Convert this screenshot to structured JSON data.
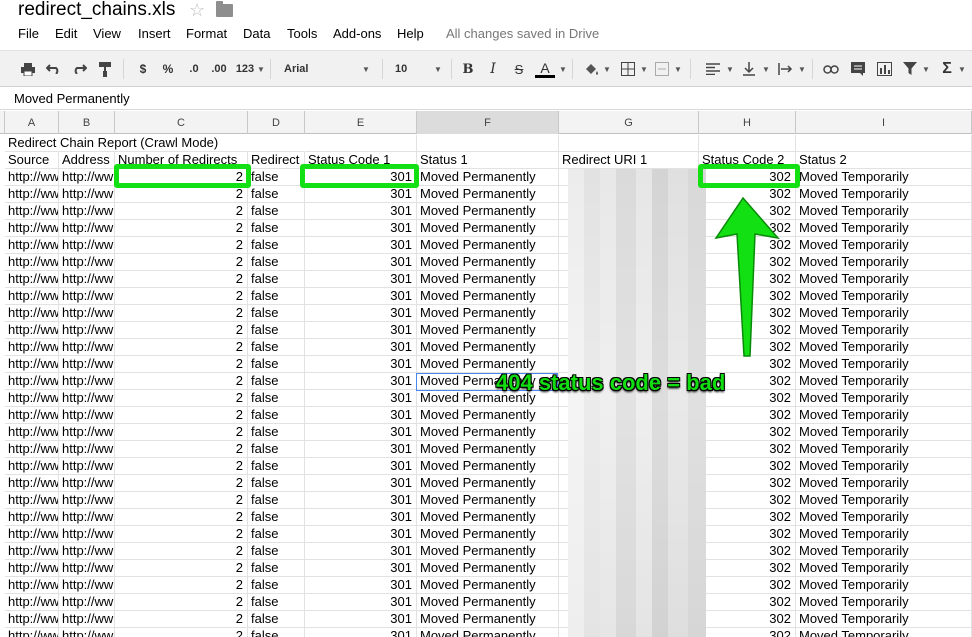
{
  "title_bar": {
    "doc_title": "redirect_chains.xls",
    "star_icon": "star-icon",
    "folder_icon": "folder-icon"
  },
  "menu": {
    "items": [
      "File",
      "Edit",
      "View",
      "Insert",
      "Format",
      "Data",
      "Tools",
      "Add-ons",
      "Help"
    ],
    "save_status": "All changes saved in Drive"
  },
  "toolbar": {
    "currency_label": "$",
    "percent_label": "%",
    "decrease_decimals_label": ".0",
    "increase_decimals_label": ".00",
    "number_format_label": "123",
    "font_name": "Arial",
    "font_size": "10",
    "bold_label": "B",
    "italic_label": "I",
    "strikethrough_label": "S",
    "text_color_label": "A",
    "sum_label": "Σ"
  },
  "formula_bar": {
    "value": "Moved Permanently"
  },
  "columns": [
    "A",
    "B",
    "C",
    "D",
    "E",
    "F",
    "G",
    "H",
    "I"
  ],
  "sheet": {
    "report_title": "Redirect Chain Report (Crawl Mode)",
    "headers": [
      "Source",
      "Address",
      "Number of Redirects",
      "Redirect",
      "Status Code 1",
      "Status 1",
      "Redirect URI 1",
      "Status Code 2",
      "Status 2"
    ],
    "row_template": {
      "source": "http://ww",
      "address": "http://ww",
      "redirects": "2",
      "redirect_loop": "false",
      "status_code_1": "301",
      "status_1": "Moved Permanently",
      "status_code_2": "302",
      "status_2": "Moved Temporarily"
    },
    "data_row_count": 28
  },
  "annotation": {
    "text": "404 status code = bad",
    "color": "#11dd11"
  },
  "colors": {
    "highlight": "#13e013",
    "selection": "#4a87ee"
  }
}
